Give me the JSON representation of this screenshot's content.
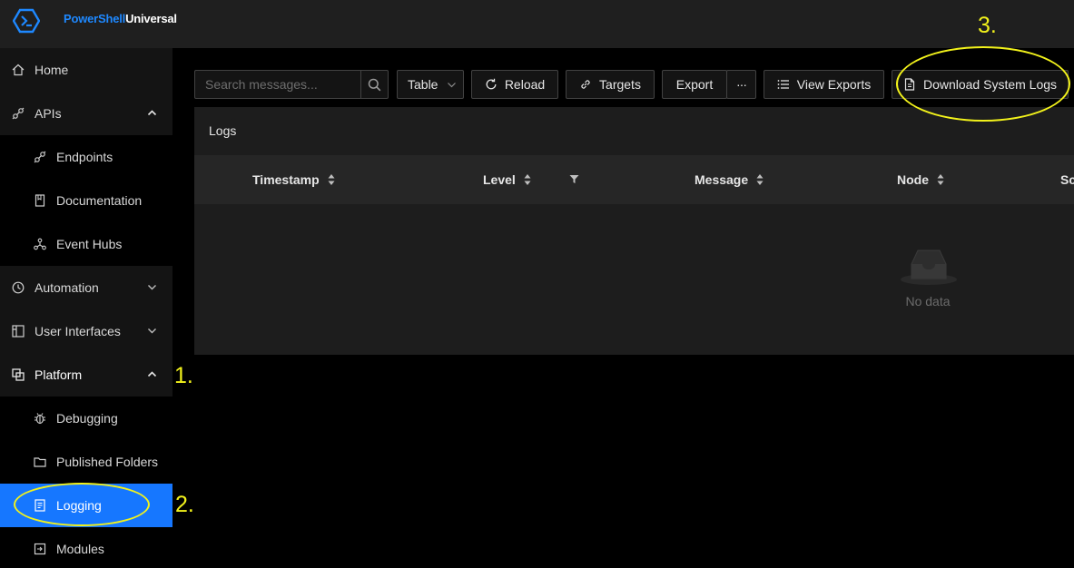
{
  "app": {
    "brand_part1": "PowerShell",
    "brand_part2": "Universal"
  },
  "sidebar": {
    "items": [
      {
        "label": "Home",
        "icon": "home-icon"
      },
      {
        "label": "APIs",
        "icon": "api-icon",
        "expanded": true
      },
      {
        "label": "Endpoints",
        "icon": "api-icon"
      },
      {
        "label": "Documentation",
        "icon": "book-icon"
      },
      {
        "label": "Event Hubs",
        "icon": "hub-icon"
      },
      {
        "label": "Automation",
        "icon": "clock-icon",
        "expanded": false
      },
      {
        "label": "User Interfaces",
        "icon": "layout-icon",
        "expanded": false
      },
      {
        "label": "Platform",
        "icon": "platform-icon",
        "expanded": true
      },
      {
        "label": "Debugging",
        "icon": "bug-icon"
      },
      {
        "label": "Published Folders",
        "icon": "folder-icon"
      },
      {
        "label": "Logging",
        "icon": "file-text-icon",
        "active": true
      },
      {
        "label": "Modules",
        "icon": "module-icon"
      }
    ]
  },
  "toolbar": {
    "search_placeholder": "Search messages...",
    "view_select": "Table",
    "reload": "Reload",
    "targets": "Targets",
    "export": "Export",
    "more": "···",
    "view_exports": "View Exports",
    "download_system_logs": "Download System Logs"
  },
  "logs": {
    "title": "Logs",
    "columns": [
      "Timestamp",
      "Level",
      "Message",
      "Node",
      "Sc"
    ],
    "empty_text": "No data"
  },
  "annotations": [
    "1.",
    "2.",
    "3."
  ],
  "colors": {
    "accent": "#1677ff",
    "annotation": "#f2f21b",
    "brand": "#1e88ff"
  }
}
